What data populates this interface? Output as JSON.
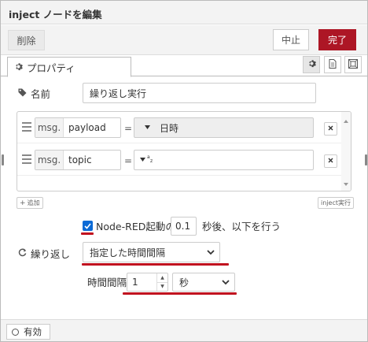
{
  "tray": {
    "title": "inject ノードを編集",
    "delete_label": "削除",
    "cancel_label": "中止",
    "done_label": "完了"
  },
  "tabs": {
    "properties_label": "プロパティ"
  },
  "form": {
    "name_label": "名前",
    "name_value": "繰り返し実行",
    "props": [
      {
        "prefix": "msg.",
        "key": "payload",
        "eq": "=",
        "type_icon": "timestamp",
        "value": "日時"
      },
      {
        "prefix": "msg.",
        "key": "topic",
        "eq": "=",
        "type_icon": "string",
        "value": ""
      }
    ],
    "add_label": "追加",
    "inject_now_label": "inject実行",
    "once_label": "Node-RED起動の",
    "once_delay": "0.1",
    "once_suffix": "秒後、以下を行う",
    "repeat_label": "繰り返し",
    "repeat_value": "指定した時間間隔",
    "interval_label": "時間間隔",
    "interval_value": "1",
    "interval_unit": "秒"
  },
  "footer": {
    "enable_label": "有効"
  },
  "colors": {
    "done_button": "#ad1625",
    "checkbox": "#0b6ad6",
    "highlight_underline": "#c1121f"
  }
}
